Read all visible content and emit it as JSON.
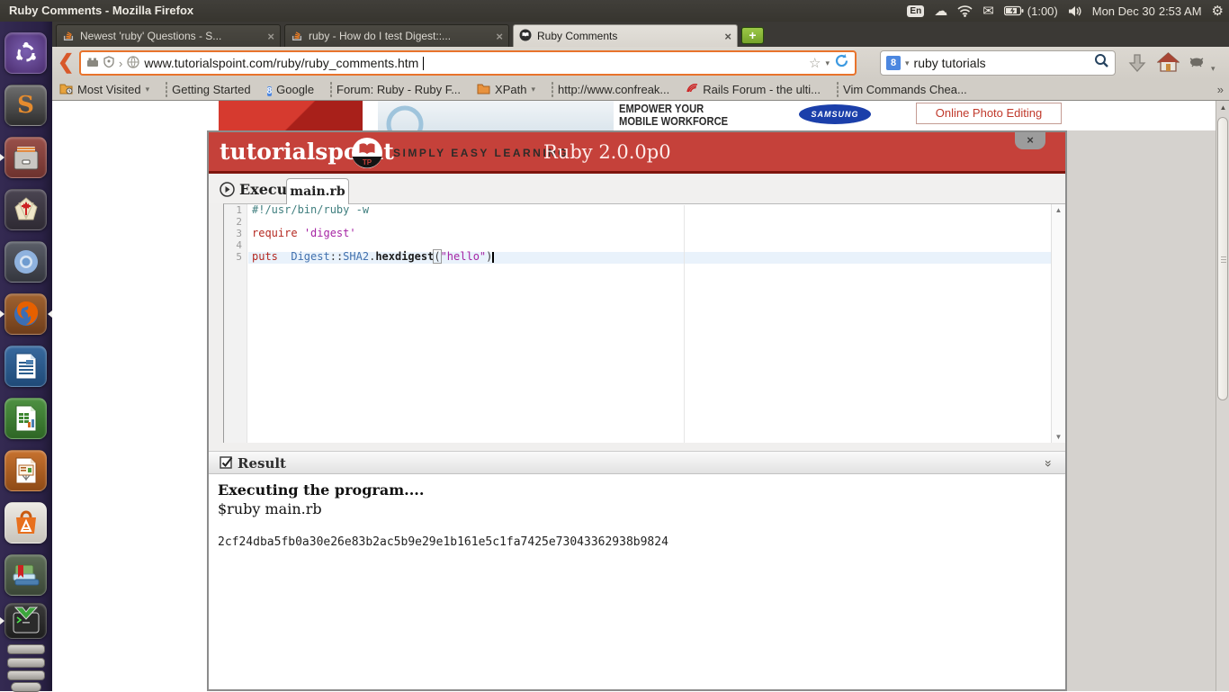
{
  "glyphs": {
    "close_x": "×",
    "new_tab_plus": "+",
    "dropdown_arrow": "▾",
    "back_chevron": "❮",
    "overflow_chevron": "»",
    "collapse_chevron": "»",
    "star": "☆",
    "gear": "⚙",
    "cloud": "☁",
    "envelope": "✉",
    "chevron_right": "›",
    "google_badge": "8",
    "scroll_up_arrow": "▲",
    "scroll_down_arrow": "▼",
    "check": "✓"
  },
  "panel": {
    "window_title": "Ruby Comments - Mozilla Firefox",
    "keyboard_indicator": "En",
    "battery_time": "(1:00)",
    "date": "Mon Dec 30",
    "time": "2:53 AM"
  },
  "tabstrip": {
    "tabs": [
      {
        "label": "Newest 'ruby' Questions - S...",
        "favicon": "stackoverflow",
        "active": false
      },
      {
        "label": "ruby - How do I test Digest::...",
        "favicon": "stackoverflow",
        "active": false
      },
      {
        "label": "Ruby Comments",
        "favicon": "tutorialspoint",
        "active": true
      }
    ]
  },
  "navbar": {
    "url": "www.tutorialspoint.com/ruby/ruby_comments.htm",
    "search_value": "ruby tutorials",
    "search_engine": "Google"
  },
  "bookmarks": {
    "items": [
      {
        "label": "Most Visited",
        "icon": "folder-history",
        "dropdown": true
      },
      {
        "label": "Getting Started",
        "icon": "default",
        "dropdown": false
      },
      {
        "label": "Google",
        "icon": "google",
        "dropdown": false
      },
      {
        "label": "Forum: Ruby - Ruby F...",
        "icon": "default",
        "dropdown": false
      },
      {
        "label": "XPath",
        "icon": "folder",
        "dropdown": true
      },
      {
        "label": "http://www.confreak...",
        "icon": "default",
        "dropdown": false
      },
      {
        "label": "Rails Forum - the ulti...",
        "icon": "rails",
        "dropdown": false
      },
      {
        "label": "Vim Commands Chea...",
        "icon": "default",
        "dropdown": false
      }
    ]
  },
  "page": {
    "ad_headline_1": "EMPOWER YOUR",
    "ad_headline_2": "MOBILE WORKFORCE",
    "samsung_label": "SAMSUNG",
    "photo_link": "Online Photo Editing"
  },
  "coding_ground": {
    "brand": "tutorialspoint",
    "logo_monogram": "TP",
    "tagline": "SIMPLY EASY LEARNING",
    "title": "Ruby 2.0.0p0",
    "execute_label": "Execute",
    "file_tab": "main.rb",
    "editor": {
      "syntax_colors": {
        "comment": "#407F7F",
        "keyword": "#B52A22",
        "string": "#A625A4",
        "support": "#4271AE",
        "method": "#1C1C1C",
        "plain": "#3B3B3B",
        "paren": "#3B3B3B"
      },
      "lines": [
        {
          "n": "1",
          "segs": [
            [
              "comment",
              "#!/usr/bin/ruby -w"
            ]
          ]
        },
        {
          "n": "2",
          "segs": []
        },
        {
          "n": "3",
          "segs": [
            [
              "keyword",
              "require"
            ],
            [
              "plain",
              " "
            ],
            [
              "string",
              "'digest'"
            ]
          ]
        },
        {
          "n": "4",
          "segs": []
        },
        {
          "n": "5",
          "active": true,
          "cursor": true,
          "segs": [
            [
              "keyword",
              "puts"
            ],
            [
              "plain",
              "  "
            ],
            [
              "support",
              "Digest"
            ],
            [
              "plain",
              "::"
            ],
            [
              "support",
              "SHA2"
            ],
            [
              "plain",
              "."
            ],
            [
              "method",
              "hexdigest"
            ],
            [
              "paren",
              "("
            ],
            [
              "string",
              "\"hello\""
            ],
            [
              "plain",
              ")"
            ]
          ]
        }
      ]
    },
    "result": {
      "title": "Result",
      "line_bold": "Executing the program....",
      "line_cmd": "$ruby main.rb",
      "output": "2cf24dba5fb0a30e26e83b2ac5b9e29e1b161e5c1fa7425e73043362938b9824"
    }
  }
}
